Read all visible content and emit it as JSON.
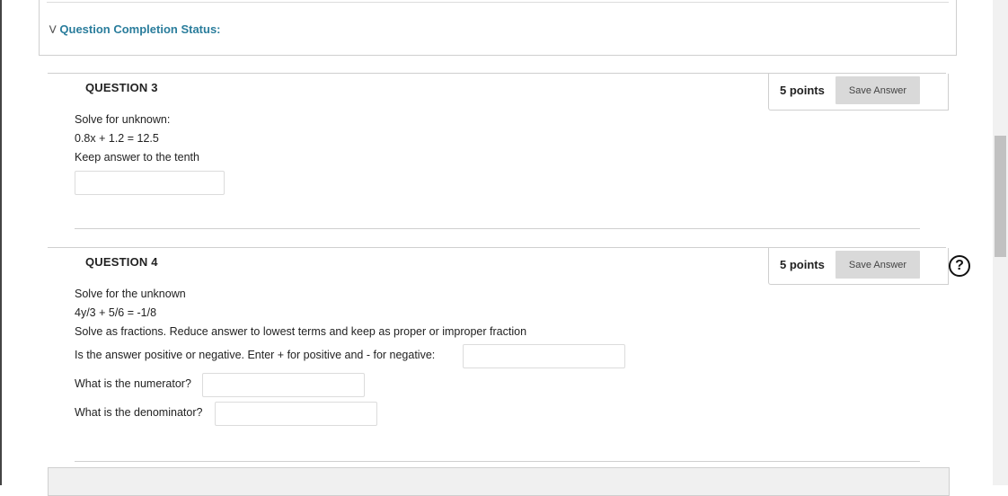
{
  "completion_status": {
    "label": "Question Completion Status:"
  },
  "questions": [
    {
      "title": "QUESTION 3",
      "points": "5 points",
      "save_label": "Save Answer",
      "lines": [
        "Solve for unknown:",
        "0.8x + 1.2 = 12.5",
        "Keep answer to the tenth"
      ],
      "answer_value": ""
    },
    {
      "title": "QUESTION 4",
      "points": "5 points",
      "save_label": "Save Answer",
      "lines": [
        "Solve for the unknown",
        "4y/3 + 5/6 = -1/8",
        "Solve as fractions. Reduce answer to lowest terms and keep as proper or improper fraction"
      ],
      "sign_prompt": "Is the answer positive or negative. Enter + for positive and - for negative:",
      "sign_value": "",
      "numerator_prompt": "What is the numerator?",
      "numerator_value": "",
      "denominator_prompt": "What is the denominator?",
      "denominator_value": ""
    }
  ],
  "help": {
    "icon": "question-circle-icon",
    "glyph": "?"
  },
  "colors": {
    "accent": "#2a7d9c",
    "button_bg": "#d9d9d9",
    "border": "#cfcfcf"
  }
}
